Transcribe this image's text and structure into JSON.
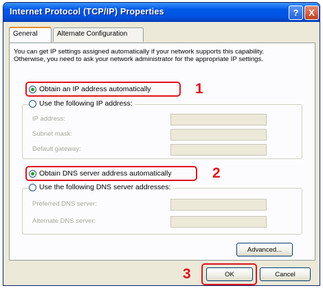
{
  "window": {
    "title": "Internet Protocol (TCP/IP) Properties",
    "help_label": "?",
    "close_label": "X"
  },
  "tabs": [
    {
      "label": "General"
    },
    {
      "label": "Alternate Configuration"
    }
  ],
  "intro_text": "You can get IP settings assigned automatically if your network supports this capability. Otherwise, you need to ask your network administrator for the appropriate IP settings.",
  "ip": {
    "auto_label": "Obtain an IP address automatically",
    "manual_label": "Use the following IP address:",
    "fields": [
      {
        "label": "IP address:",
        "value": ""
      },
      {
        "label": "Subnet mask:",
        "value": ""
      },
      {
        "label": "Default gateway:",
        "value": ""
      }
    ]
  },
  "dns": {
    "auto_label": "Obtain DNS server address automatically",
    "manual_label": "Use the following DNS server addresses:",
    "fields": [
      {
        "label": "Preferred DNS server:",
        "value": ""
      },
      {
        "label": "Alternate DNS server:",
        "value": ""
      }
    ]
  },
  "buttons": {
    "advanced": "Advanced...",
    "ok": "OK",
    "cancel": "Cancel"
  },
  "annotations": {
    "step1": "1",
    "step2": "2",
    "step3": "3"
  },
  "colors": {
    "highlight": "#e0141e",
    "titlebar": "#0054e3",
    "window_bg": "#ece9d8"
  }
}
